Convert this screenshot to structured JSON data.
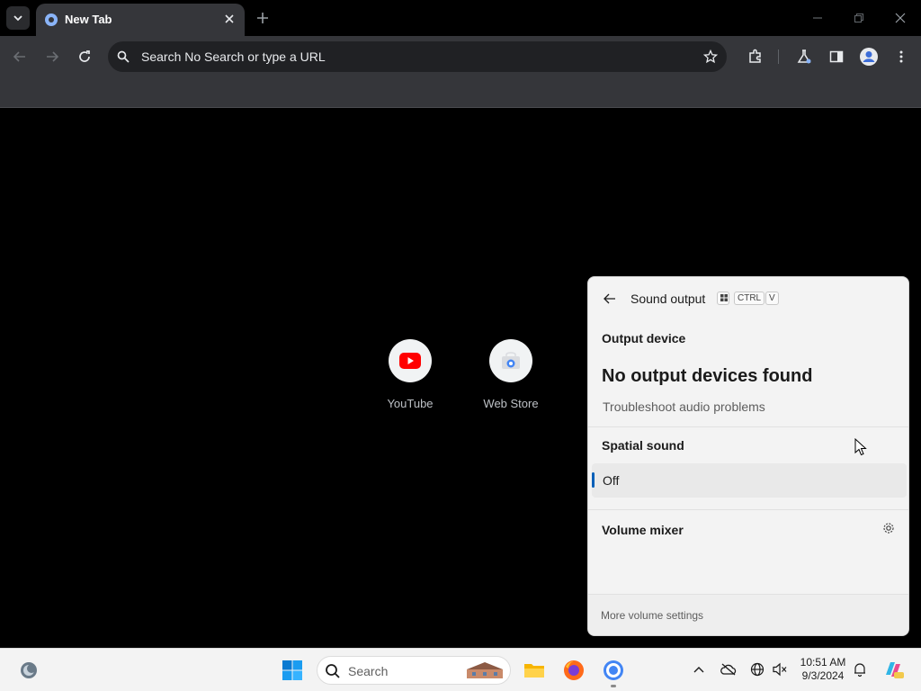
{
  "browser": {
    "tab_title": "New Tab",
    "omnibox_placeholder": "Search No Search or type a URL"
  },
  "shortcuts": [
    {
      "label": "YouTube",
      "icon": "youtube-icon"
    },
    {
      "label": "Web Store",
      "icon": "web-store-icon"
    }
  ],
  "sound_flyout": {
    "title": "Sound output",
    "shortcut_keys": [
      "CTRL",
      "V"
    ],
    "output_device_heading": "Output device",
    "no_devices_text": "No output devices found",
    "troubleshoot_link": "Troubleshoot audio problems",
    "spatial_sound_heading": "Spatial sound",
    "spatial_sound_value": "Off",
    "volume_mixer_heading": "Volume mixer",
    "more_settings_link": "More volume settings"
  },
  "taskbar": {
    "search_label": "Search",
    "time": "10:51 AM",
    "date": "9/3/2024",
    "pinned_icons": [
      "windows-start-icon",
      "file-explorer-icon",
      "firefox-icon",
      "chrome-icon"
    ]
  },
  "colors": {
    "accent": "#005fb8",
    "browser_frame": "#35363a",
    "page_bg": "#000000",
    "youtube_red": "#ff0000"
  }
}
